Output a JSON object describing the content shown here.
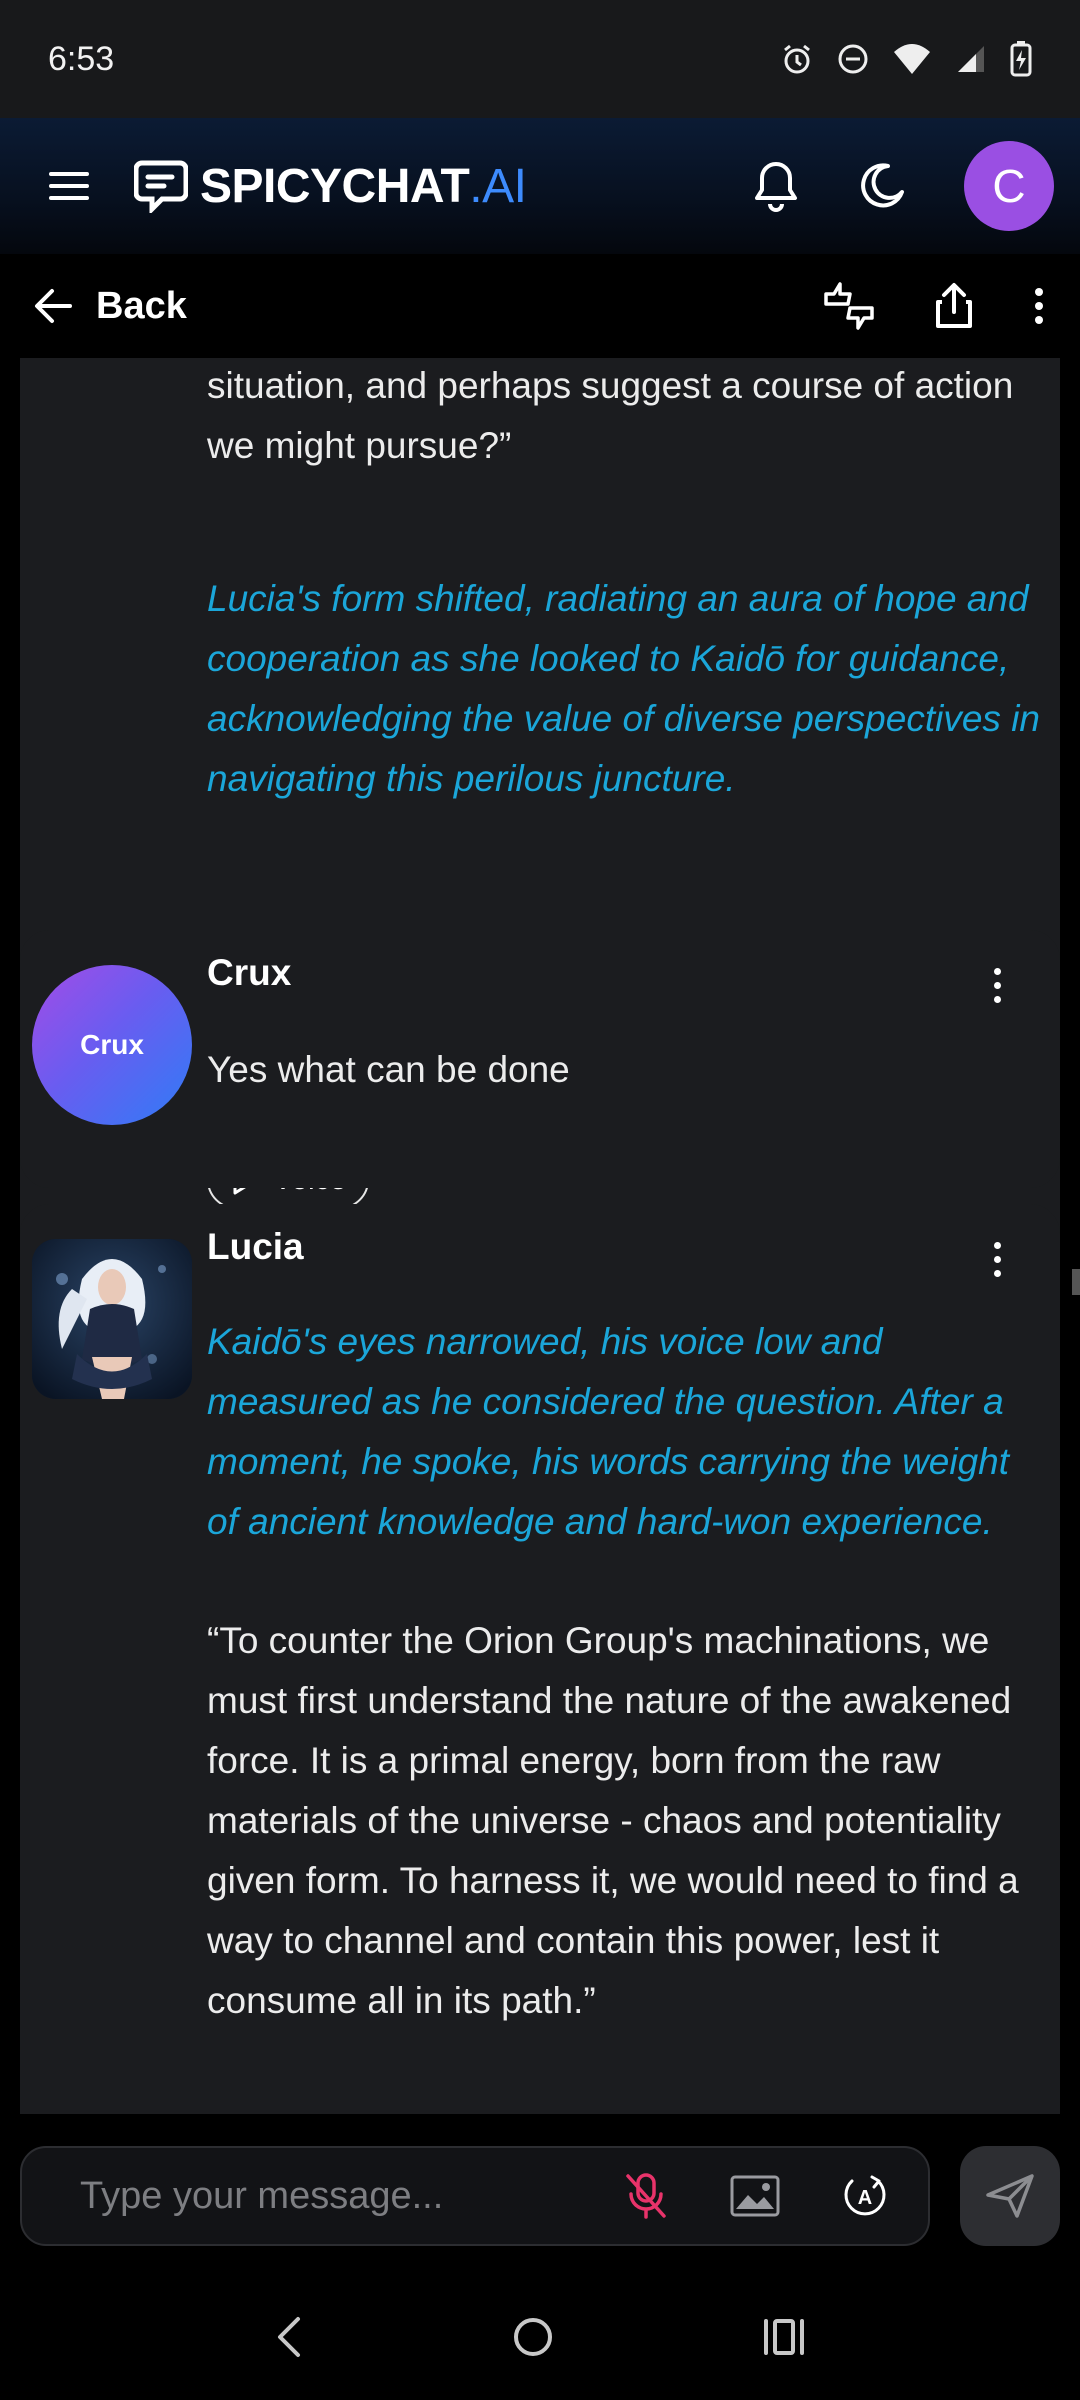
{
  "status_bar": {
    "time": "6:53",
    "icons": [
      "alarm-icon",
      "dnd-icon",
      "wifi-icon",
      "signal-icon",
      "battery-charging-icon"
    ]
  },
  "header": {
    "brand_main": "SPICYCHAT",
    "brand_accent": ".AI",
    "avatar_letter": "C",
    "accent_color": "#3d8bfd",
    "avatar_color": "#9a4fe3"
  },
  "nav": {
    "back_label": "Back"
  },
  "messages": [
    {
      "sender": "",
      "paragraphs": [
        "situation, and perhaps suggest a course of action we might pursue?”"
      ],
      "actions": "Lucia's form shifted, radiating an aura of hope and cooperation as she looked to Kaidō for guidance, acknowledging the value of diverse perspectives in navigating this perilous juncture.",
      "voice_label": "Voice"
    },
    {
      "sender": "Crux",
      "avatar_text": "Crux",
      "text": "Yes what can be done"
    },
    {
      "sender": "Lucia",
      "actions": "Kaidō's eyes narrowed, his voice low and measured as he considered the question. After a moment, he spoke, his words carrying the weight of ancient knowledge and hard-won experience.",
      "text": "“To counter the Orion Group's machinations, we must first understand the nature of the awakened force. It is a primal energy, born from the raw materials of the universe - chaos and potentiality given form. To harness it, we would need to find a way to channel and contain this power, lest it consume all in its path.”"
    }
  ],
  "composer": {
    "placeholder": "Type your message...",
    "mic_color": "#e8336a"
  },
  "colors": {
    "action_text": "#1ba6d9",
    "card_bg": "#1b1c1f"
  }
}
